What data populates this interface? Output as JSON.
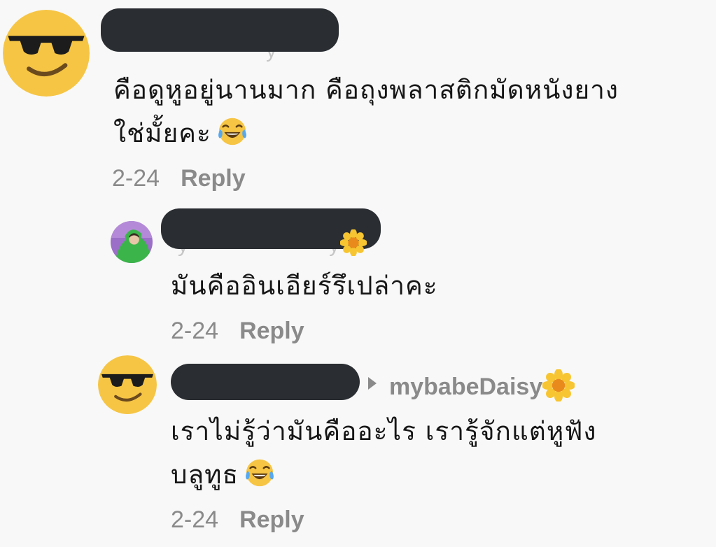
{
  "comments": [
    {
      "text_lines": [
        "คือดูหูอยู่นานมาก คือถุงพลาสติกมัดหนังยาง",
        "ใช่มั้ยคะ"
      ],
      "emoji": "face-with-tears-of-joy",
      "date": "2-24",
      "reply_label": "Reply",
      "avatar": "sunglasses-emoji"
    },
    {
      "text_lines": [
        "มันคืออินเอียร์รึเปล่าคะ"
      ],
      "date": "2-24",
      "reply_label": "Reply",
      "avatar": "photo-person-green-hoodie"
    },
    {
      "reply_to": "mybabeDaisy",
      "reply_to_emoji": "sunflower",
      "text_lines": [
        "เราไม่รู้ว่ามันคืออะไร เรารู้จักแต่หูฟัง",
        "บลูทูธ"
      ],
      "emoji": "face-with-tears-of-joy",
      "date": "2-24",
      "reply_label": "Reply",
      "avatar": "sunglasses-emoji"
    }
  ],
  "colors": {
    "background": "#f8f8f8",
    "redaction": "#2a2e32",
    "meta_text": "#8a8a8a",
    "emoji_yellow": "#f6c544"
  }
}
